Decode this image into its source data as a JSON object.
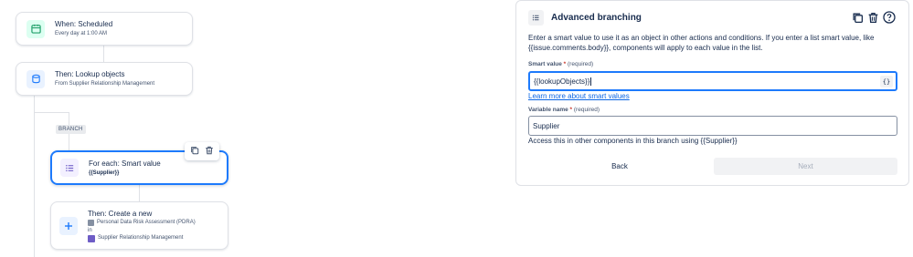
{
  "flow": {
    "trigger": {
      "title": "When: Scheduled",
      "subtitle": "Every day at 1:00 AM"
    },
    "lookup": {
      "title": "Then: Lookup objects",
      "subtitle": "From Supplier Relationship Management"
    },
    "branch_tag": "BRANCH",
    "foreach": {
      "title": "For each: Smart value",
      "subtitle": "{{Supplier}}"
    },
    "create": {
      "title": "Then: Create a new",
      "object_type": "Personal Data Risk Assessment (PDRA)",
      "in_label": "in",
      "schema": "Supplier Relationship Management"
    }
  },
  "panel": {
    "title": "Advanced branching",
    "description": "Enter a smart value to use it as an object in other actions and conditions. If you enter a list smart value, like {{issue.comments.body}}, components will apply to each value in the list.",
    "smart_value": {
      "label": "Smart value",
      "required_mark": "*",
      "required_text": "(required)",
      "value": "{{lookupObjects}}",
      "brace_button": "{}"
    },
    "learn_more": "Learn more about smart values",
    "variable_name": {
      "label": "Variable name",
      "required_mark": "*",
      "required_text": "(required)",
      "value": "Supplier",
      "helper": "Access this in other components in this branch using {{Supplier}}"
    },
    "back_button": "Back",
    "next_button": "Next"
  },
  "colors": {
    "accent": "#1d7afc",
    "trigger_icon_bg": "#dcfff1",
    "trigger_icon": "#22a06b",
    "action_icon_bg": "#e9f2ff",
    "action_icon": "#1d7afc",
    "foreach_icon_bg": "#f3f0ff",
    "foreach_icon": "#6e5dc6"
  },
  "icons": {
    "trigger": "calendar-icon",
    "lookup": "database-icon",
    "foreach": "list-icon",
    "create": "plus-icon",
    "copy": "copy-icon",
    "delete": "trash-icon",
    "help": "help-icon"
  }
}
